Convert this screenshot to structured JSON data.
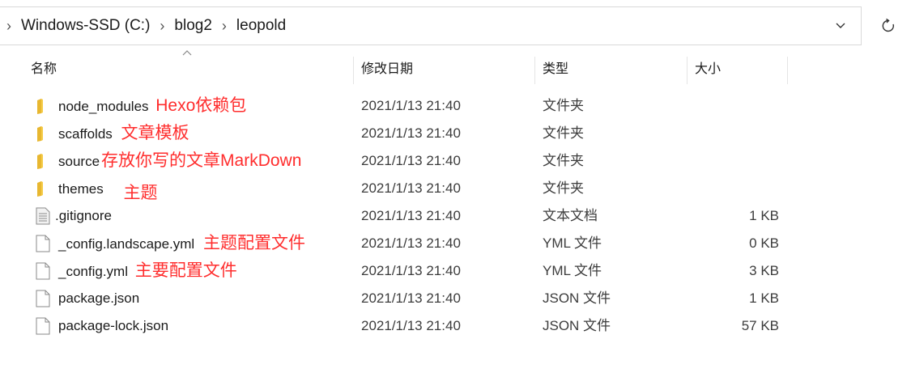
{
  "breadcrumb": {
    "items": [
      "Windows-SSD (C:)",
      "blog2",
      "leopold"
    ]
  },
  "columns": {
    "name": "名称",
    "date": "修改日期",
    "type": "类型",
    "size": "大小"
  },
  "files": [
    {
      "name": "node_modules",
      "annotation": "Hexo依赖包",
      "date": "2021/1/13 21:40",
      "type": "文件夹",
      "size": "",
      "icon": "folder-icon"
    },
    {
      "name": "scaffolds",
      "annotation": "文章模板",
      "date": "2021/1/13 21:40",
      "type": "文件夹",
      "size": "",
      "icon": "folder-icon"
    },
    {
      "name": "source",
      "annotation": "存放你写的文章MarkDown",
      "date": "2021/1/13 21:40",
      "type": "文件夹",
      "size": "",
      "icon": "folder-icon"
    },
    {
      "name": "themes",
      "annotation": "主题",
      "date": "2021/1/13 21:40",
      "type": "文件夹",
      "size": "",
      "icon": "folder-icon"
    },
    {
      "name": ".gitignore",
      "annotation": "",
      "date": "2021/1/13 21:40",
      "type": "文本文档",
      "size": "1 KB",
      "icon": "text-file-icon"
    },
    {
      "name": "_config.landscape.yml",
      "annotation": "主题配置文件",
      "date": "2021/1/13 21:40",
      "type": "YML 文件",
      "size": "0 KB",
      "icon": "file-icon"
    },
    {
      "name": "_config.yml",
      "annotation": "主要配置文件",
      "date": "2021/1/13 21:40",
      "type": "YML 文件",
      "size": "3 KB",
      "icon": "file-icon"
    },
    {
      "name": "package.json",
      "annotation": "",
      "date": "2021/1/13 21:40",
      "type": "JSON 文件",
      "size": "1 KB",
      "icon": "file-icon"
    },
    {
      "name": "package-lock.json",
      "annotation": "",
      "date": "2021/1/13 21:40",
      "type": "JSON 文件",
      "size": "57 KB",
      "icon": "file-icon"
    }
  ],
  "colors": {
    "annotation": "#ff2d2d",
    "folder": "#e8b730"
  }
}
